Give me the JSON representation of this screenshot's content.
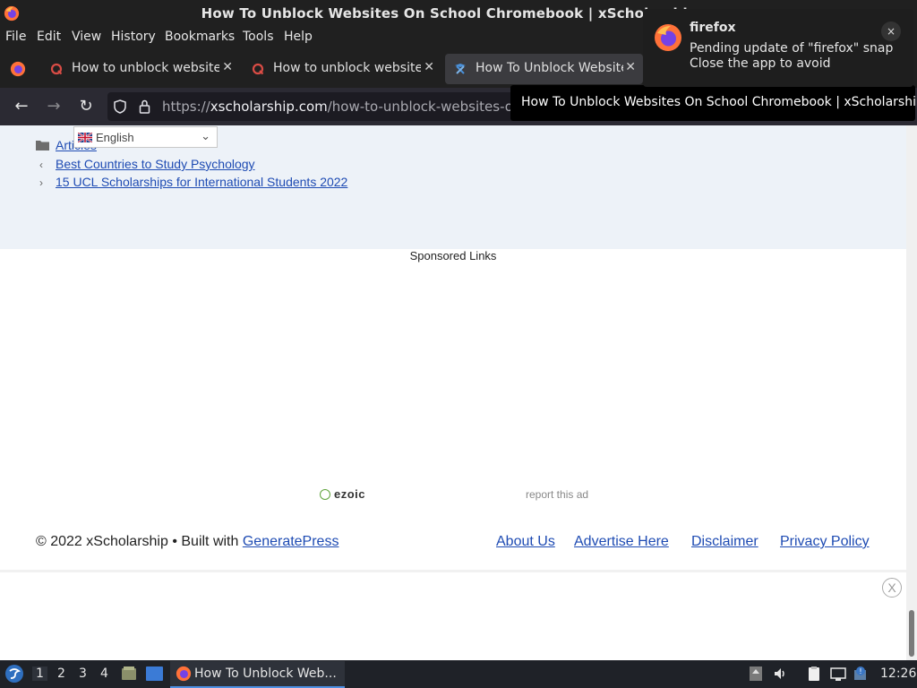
{
  "window": {
    "title": "How To Unblock Websites On School Chromebook | xScholarship —"
  },
  "menubar": {
    "items": [
      "File",
      "Edit",
      "View",
      "History",
      "Bookmarks",
      "Tools",
      "Help"
    ]
  },
  "tabs": [
    {
      "label": "How to unblock websites",
      "active": false
    },
    {
      "label": "How to unblock websites",
      "active": false
    },
    {
      "label": "How To Unblock Website",
      "active": true
    }
  ],
  "navbar": {
    "url_prefix": "https://",
    "url_domain": "xscholarship.com",
    "url_path": "/how-to-unblock-websites-on-s"
  },
  "tooltip": {
    "text": "How To Unblock Websites On School Chromebook | xScholarship"
  },
  "notification": {
    "app": "firefox",
    "line1": "Pending update of \"firefox\" snap",
    "line2": "Close the app to avoid",
    "close": "×"
  },
  "page": {
    "category": "Articles",
    "language": "English",
    "prev_post": "Best Countries to Study Psychology",
    "next_post": "15 UCL Scholarships for International Students 2022",
    "sponsored": "Sponsored Links",
    "ezoic": "ezoic",
    "report_ad": "report this ad",
    "footer_copyright": "© 2022 xScholarship • Built with ",
    "footer_builder": "GeneratePress",
    "footer_links": [
      "About Us",
      "Advertise Here",
      "Disclaimer",
      "Privacy Policy"
    ],
    "ad_close": "X"
  },
  "taskbar": {
    "workspaces": [
      "1",
      "2",
      "3",
      "4"
    ],
    "task_label": "How To Unblock Web...",
    "clock": "12:26"
  },
  "colors": {
    "link": "#1e4bb3",
    "postnav_bg": "#edf2f8",
    "chrome_bg": "#202020"
  }
}
